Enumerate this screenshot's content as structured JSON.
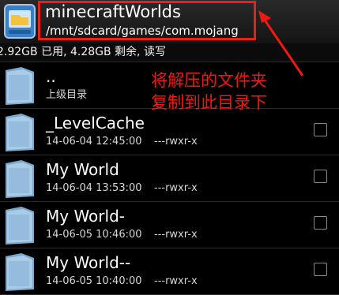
{
  "header": {
    "title": "minecraftWorlds",
    "path": "/mnt/sdcard/games/com.mojang"
  },
  "storage_text": "2.92GB 已用, 4.28GB 剩余, 读写",
  "rows": [
    {
      "name": "..",
      "meta": "上级目录"
    },
    {
      "name": "_LevelCache",
      "date": "14-06-04 12:45:00",
      "perm": "---rwxr-x"
    },
    {
      "name": "My World",
      "date": "14-06-04 13:53:00",
      "perm": "---rwxr-x"
    },
    {
      "name": "My World-",
      "date": "14-06-05 10:46:00",
      "perm": "---rwxr-x"
    },
    {
      "name": "My World--",
      "date": "14-06-05 10:40:00",
      "perm": "---rwxr-x"
    }
  ],
  "annotation": {
    "line1": "将解压的文件夹",
    "line2": "复制到此目录下"
  },
  "colors": {
    "annotation": "#f01812",
    "background": "#000000"
  }
}
